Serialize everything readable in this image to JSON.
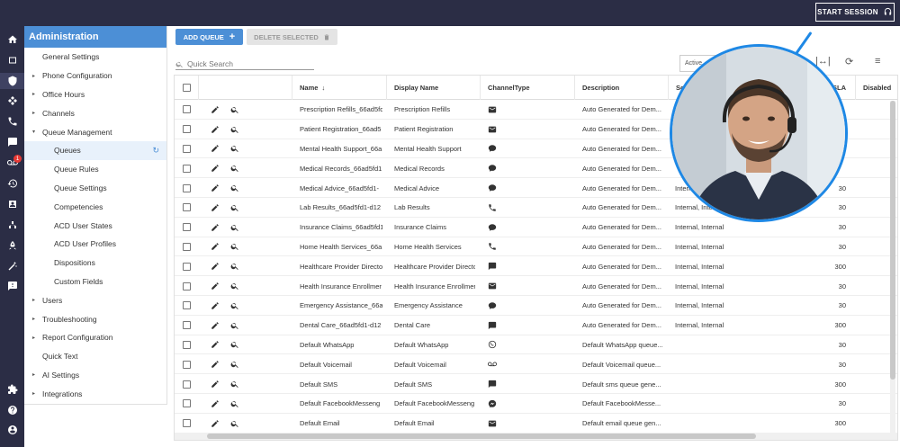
{
  "topbar": {
    "start_session_label": "START SESSION",
    "start_session_icon": "headset-icon"
  },
  "rail": {
    "icons": [
      "home-icon",
      "folder-icon",
      "shield-icon",
      "network-icon",
      "phone-icon",
      "chat-icon",
      "voicemail-icon",
      "history-icon",
      "contacts-icon",
      "flow-icon",
      "rocket-icon",
      "magic-wand-icon",
      "feedback-icon",
      "puzzle-icon",
      "help-icon",
      "account-icon"
    ],
    "voicemail_badge": "1"
  },
  "sidebar": {
    "title": "Administration",
    "items": [
      {
        "label": "General Settings",
        "level": 0,
        "caret": ""
      },
      {
        "label": "Phone Configuration",
        "level": 0,
        "caret": "▸"
      },
      {
        "label": "Office Hours",
        "level": 0,
        "caret": "▸"
      },
      {
        "label": "Channels",
        "level": 0,
        "caret": "▸"
      },
      {
        "label": "Queue Management",
        "level": 0,
        "caret": "▾"
      },
      {
        "label": "Queues",
        "level": 1,
        "caret": "",
        "active": true
      },
      {
        "label": "Queue Rules",
        "level": 1,
        "caret": ""
      },
      {
        "label": "Queue Settings",
        "level": 1,
        "caret": ""
      },
      {
        "label": "Competencies",
        "level": 1,
        "caret": ""
      },
      {
        "label": "ACD User States",
        "level": 1,
        "caret": ""
      },
      {
        "label": "ACD User Profiles",
        "level": 1,
        "caret": ""
      },
      {
        "label": "Dispositions",
        "level": 1,
        "caret": ""
      },
      {
        "label": "Custom Fields",
        "level": 1,
        "caret": ""
      },
      {
        "label": "Users",
        "level": 0,
        "caret": "▸"
      },
      {
        "label": "Troubleshooting",
        "level": 0,
        "caret": "▸"
      },
      {
        "label": "Report Configuration",
        "level": 0,
        "caret": "▸"
      },
      {
        "label": "Quick Text",
        "level": 0,
        "caret": ""
      },
      {
        "label": "AI Settings",
        "level": 0,
        "caret": "▸"
      },
      {
        "label": "Integrations",
        "level": 0,
        "caret": "▸"
      }
    ]
  },
  "toolbar": {
    "add_queue_label": "ADD QUEUE",
    "delete_selected_label": "DELETE SELECTED"
  },
  "search": {
    "placeholder": "Quick Search"
  },
  "filter": {
    "selected": "Active"
  },
  "table": {
    "columns": [
      "Name",
      "Display Name",
      "ChannelType",
      "Description",
      "Sc",
      "SLA",
      "Disabled"
    ],
    "rows": [
      {
        "name": "Prescription Refills_66ad5fd",
        "display": "Prescription Refills",
        "channel": "email",
        "description": "Auto Generated for Dem...",
        "scope": "",
        "sla": ""
      },
      {
        "name": "Patient Registration_66ad5",
        "display": "Patient Registration",
        "channel": "email",
        "description": "Auto Generated for Dem...",
        "scope": "",
        "sla": ""
      },
      {
        "name": "Mental Health Support_66a",
        "display": "Mental Health Support",
        "channel": "chat",
        "description": "Auto Generated for Dem...",
        "scope": "",
        "sla": ""
      },
      {
        "name": "Medical Records_66ad5fd1",
        "display": "Medical Records",
        "channel": "chat",
        "description": "Auto Generated for Dem...",
        "scope": "",
        "sla": ""
      },
      {
        "name": "Medical Advice_66ad5fd1-",
        "display": "Medical Advice",
        "channel": "chat",
        "description": "Auto Generated for Dem...",
        "scope": "Internal, Internal",
        "sla": "30"
      },
      {
        "name": "Lab Results_66ad5fd1-d12",
        "display": "Lab Results",
        "channel": "phone",
        "description": "Auto Generated for Dem...",
        "scope": "Internal, Internal",
        "sla": "30"
      },
      {
        "name": "Insurance Claims_66ad5fd1",
        "display": "Insurance Claims",
        "channel": "chat",
        "description": "Auto Generated for Dem...",
        "scope": "Internal, Internal",
        "sla": "30"
      },
      {
        "name": "Home Health Services_66a",
        "display": "Home Health Services",
        "channel": "phone",
        "description": "Auto Generated for Dem...",
        "scope": "Internal, Internal",
        "sla": "30"
      },
      {
        "name": "Healthcare Provider Directo",
        "display": "Healthcare Provider Directo",
        "channel": "sms",
        "description": "Auto Generated for Dem...",
        "scope": "Internal, Internal",
        "sla": "300"
      },
      {
        "name": "Health Insurance Enrollmer",
        "display": "Health Insurance Enrollmer",
        "channel": "email",
        "description": "Auto Generated for Dem...",
        "scope": "Internal, Internal",
        "sla": "30"
      },
      {
        "name": "Emergency Assistance_66a",
        "display": "Emergency Assistance",
        "channel": "chat",
        "description": "Auto Generated for Dem...",
        "scope": "Internal, Internal",
        "sla": "30"
      },
      {
        "name": "Dental Care_66ad5fd1-d12",
        "display": "Dental Care",
        "channel": "sms",
        "description": "Auto Generated for Dem...",
        "scope": "Internal, Internal",
        "sla": "300"
      },
      {
        "name": "Default WhatsApp",
        "display": "Default WhatsApp",
        "channel": "whatsapp",
        "description": "Default WhatsApp queue...",
        "scope": "",
        "sla": "30"
      },
      {
        "name": "Default Voicemail",
        "display": "Default Voicemail",
        "channel": "voicemail",
        "description": "Default Voicemail queue...",
        "scope": "",
        "sla": "30"
      },
      {
        "name": "Default SMS",
        "display": "Default SMS",
        "channel": "sms",
        "description": "Default sms queue gene...",
        "scope": "",
        "sla": "300"
      },
      {
        "name": "Default FacebookMesseng",
        "display": "Default FacebookMesseng",
        "channel": "messenger",
        "description": "Default FacebookMesse...",
        "scope": "",
        "sla": "30"
      },
      {
        "name": "Default Email",
        "display": "Default Email",
        "channel": "email",
        "description": "Default email queue gen...",
        "scope": "",
        "sla": "300"
      }
    ]
  },
  "colors": {
    "brand_dark": "#2b2d45",
    "accent": "#4c8fd6",
    "avatar_ring": "#1e88e5"
  }
}
